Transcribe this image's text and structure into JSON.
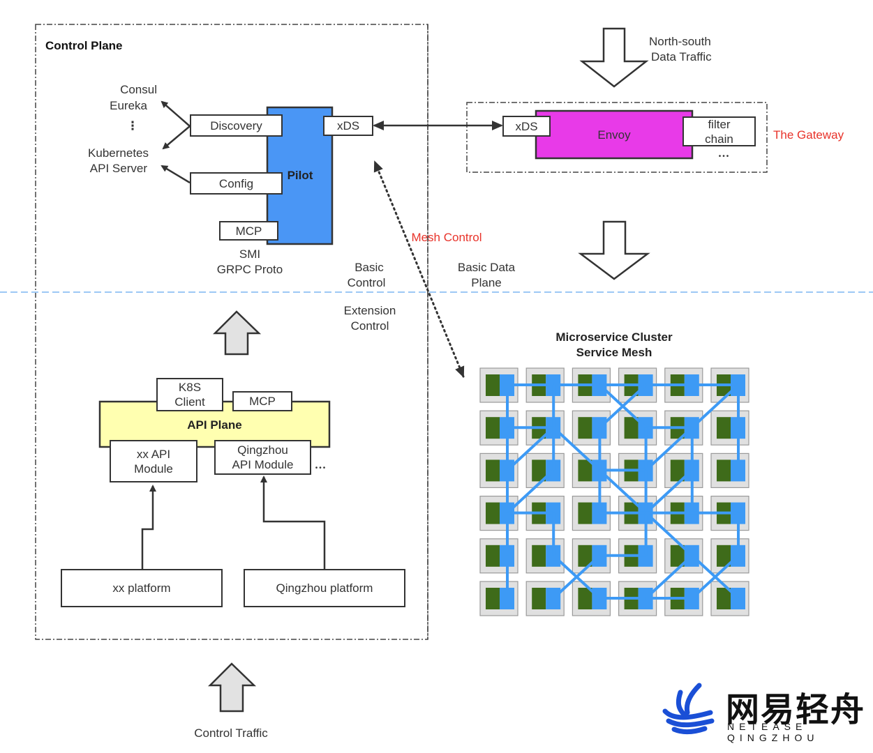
{
  "control_plane": {
    "title": "Control Plane",
    "registries": [
      "Consul",
      "Eureka",
      "⋮",
      "Kubernetes",
      "API Server"
    ],
    "pilot": {
      "label": "Pilot",
      "color": "#4a96f5",
      "ports": {
        "discovery": "Discovery",
        "config": "Config",
        "mcp": "MCP",
        "xds": "xDS"
      }
    },
    "mcp_caption": [
      "SMI",
      "GRPC Proto"
    ],
    "api_plane": {
      "label": "API Plane",
      "color": "#ffffb0",
      "top_ports": {
        "k8s_client": [
          "K8S",
          "Client"
        ],
        "mcp": "MCP"
      },
      "modules": [
        [
          "xx API",
          "Module"
        ],
        [
          "Qingzhou",
          "API Module"
        ]
      ],
      "more": "•••"
    },
    "platforms": [
      "xx platform",
      "Qingzhou platform"
    ]
  },
  "zones": {
    "basic_control": [
      "Basic",
      "Control"
    ],
    "extension_control": [
      "Extension",
      "Control"
    ],
    "basic_data_plane": [
      "Basic Data",
      "Plane"
    ],
    "mesh_control": "Mesh Control"
  },
  "gateway": {
    "label": "The Gateway",
    "traffic": [
      "North-south",
      "Data Traffic"
    ],
    "envoy": {
      "label": "Envoy",
      "color": "#e83ae8",
      "xds": "xDS",
      "filter_chain": [
        "filter",
        "chain"
      ],
      "more": "•••"
    }
  },
  "mesh": {
    "title": [
      "Microservice Cluster",
      "Service Mesh"
    ],
    "rows": 6,
    "cols": 6,
    "colors": {
      "cell": "#e0e0e0",
      "workload": "#3e6b1a",
      "sidecar": "#3d9af5"
    },
    "edges": [
      [
        [
          0,
          0
        ],
        [
          0,
          1
        ]
      ],
      [
        [
          0,
          1
        ],
        [
          0,
          2
        ]
      ],
      [
        [
          0,
          2
        ],
        [
          0,
          3
        ]
      ],
      [
        [
          0,
          3
        ],
        [
          0,
          4
        ]
      ],
      [
        [
          0,
          4
        ],
        [
          0,
          5
        ]
      ],
      [
        [
          0,
          0
        ],
        [
          1,
          0
        ]
      ],
      [
        [
          0,
          1
        ],
        [
          1,
          1
        ]
      ],
      [
        [
          0,
          2
        ],
        [
          1,
          3
        ]
      ],
      [
        [
          0,
          3
        ],
        [
          1,
          2
        ]
      ],
      [
        [
          0,
          5
        ],
        [
          1,
          4
        ]
      ],
      [
        [
          0,
          5
        ],
        [
          1,
          5
        ]
      ],
      [
        [
          1,
          0
        ],
        [
          1,
          1
        ]
      ],
      [
        [
          1,
          3
        ],
        [
          1,
          4
        ]
      ],
      [
        [
          1,
          0
        ],
        [
          2,
          0
        ]
      ],
      [
        [
          1,
          1
        ],
        [
          2,
          0
        ]
      ],
      [
        [
          1,
          1
        ],
        [
          2,
          1
        ]
      ],
      [
        [
          1,
          1
        ],
        [
          2,
          2
        ]
      ],
      [
        [
          1,
          2
        ],
        [
          2,
          2
        ]
      ],
      [
        [
          1,
          3
        ],
        [
          2,
          3
        ]
      ],
      [
        [
          1,
          4
        ],
        [
          2,
          3
        ]
      ],
      [
        [
          1,
          4
        ],
        [
          2,
          4
        ]
      ],
      [
        [
          1,
          5
        ],
        [
          2,
          5
        ]
      ],
      [
        [
          2,
          2
        ],
        [
          2,
          3
        ]
      ],
      [
        [
          2,
          0
        ],
        [
          3,
          0
        ]
      ],
      [
        [
          2,
          1
        ],
        [
          3,
          0
        ]
      ],
      [
        [
          2,
          2
        ],
        [
          3,
          2
        ]
      ],
      [
        [
          2,
          2
        ],
        [
          3,
          3
        ]
      ],
      [
        [
          2,
          3
        ],
        [
          3,
          3
        ]
      ],
      [
        [
          2,
          4
        ],
        [
          3,
          3
        ]
      ],
      [
        [
          2,
          4
        ],
        [
          3,
          4
        ]
      ],
      [
        [
          3,
          0
        ],
        [
          3,
          1
        ]
      ],
      [
        [
          3,
          2
        ],
        [
          3,
          3
        ]
      ],
      [
        [
          3,
          3
        ],
        [
          3,
          4
        ]
      ],
      [
        [
          3,
          4
        ],
        [
          3,
          5
        ]
      ],
      [
        [
          3,
          0
        ],
        [
          4,
          0
        ]
      ],
      [
        [
          3,
          1
        ],
        [
          4,
          1
        ]
      ],
      [
        [
          3,
          3
        ],
        [
          4,
          3
        ]
      ],
      [
        [
          3,
          3
        ],
        [
          4,
          4
        ]
      ],
      [
        [
          3,
          5
        ],
        [
          4,
          5
        ]
      ],
      [
        [
          4,
          2
        ],
        [
          4,
          3
        ]
      ],
      [
        [
          4,
          0
        ],
        [
          5,
          0
        ]
      ],
      [
        [
          4,
          1
        ],
        [
          5,
          2
        ]
      ],
      [
        [
          4,
          2
        ],
        [
          5,
          1
        ]
      ],
      [
        [
          4,
          4
        ],
        [
          5,
          3
        ]
      ],
      [
        [
          4,
          5
        ],
        [
          5,
          4
        ]
      ],
      [
        [
          4,
          4
        ],
        [
          5,
          5
        ]
      ],
      [
        [
          5,
          2
        ],
        [
          5,
          3
        ]
      ],
      [
        [
          5,
          3
        ],
        [
          5,
          4
        ]
      ]
    ]
  },
  "control_traffic": "Control Traffic",
  "logo": {
    "cn": "网易轻舟",
    "en": "NETEASE QINGZHOU",
    "color": "#1a4fd6"
  }
}
